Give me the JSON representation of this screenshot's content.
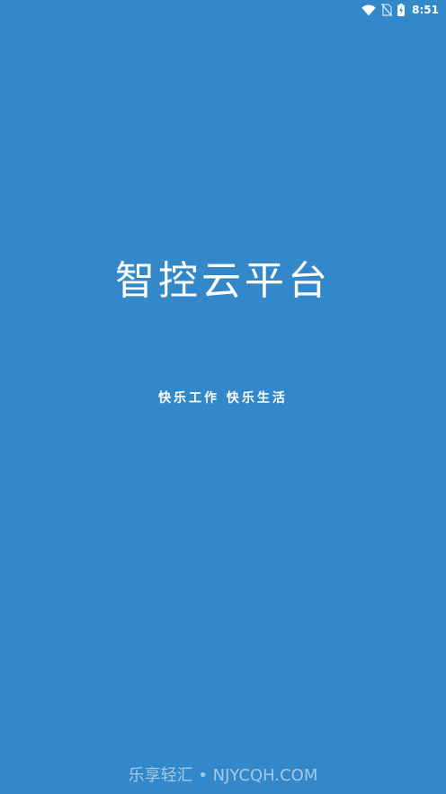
{
  "status_bar": {
    "time": "8:51",
    "icons": [
      "wifi-icon",
      "no-sim-icon",
      "battery-charging-icon"
    ]
  },
  "splash": {
    "title": "智控云平台",
    "slogan": "快乐工作  快乐生活"
  },
  "watermark": {
    "text": "乐享轻汇 • NJYCQH.COM"
  },
  "colors": {
    "background": "#3388C9",
    "text": "#FFFFFF"
  }
}
